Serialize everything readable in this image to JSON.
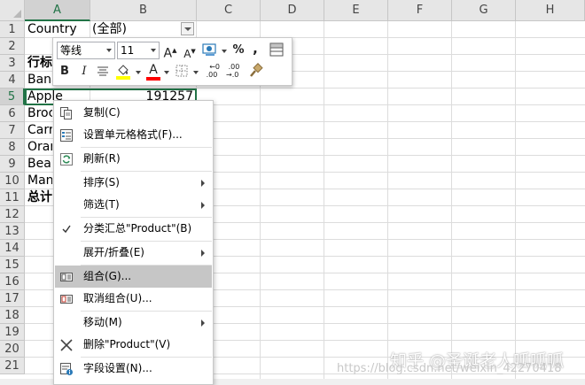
{
  "columns": [
    "A",
    "B",
    "C",
    "D",
    "E",
    "F",
    "G",
    "H"
  ],
  "selected_column": "A",
  "rows": [
    "1",
    "2",
    "3",
    "4",
    "5",
    "6",
    "7",
    "8",
    "9",
    "10",
    "11",
    "12",
    "13",
    "14",
    "15",
    "16",
    "17",
    "18",
    "19",
    "20",
    "21"
  ],
  "selected_row": "5",
  "cells": {
    "a1": "Country",
    "b1": "(全部)",
    "a3": "行标",
    "a4": "Bana",
    "a5": "Apple",
    "b5": "191257",
    "a6": "Broc",
    "a7": "Carr",
    "a8": "Orar",
    "a9": "Bear",
    "a10": "Man",
    "a11": "总计"
  },
  "mini_toolbar": {
    "font_name": "等线",
    "font_size": "11",
    "bold_label": "B",
    "italic_label": "I",
    "percent_label": "%",
    "comma_label": ",",
    "increase_font_label": "A",
    "decrease_font_label": "A",
    "font_color_label": "A",
    "increase_decimal_label": ".00",
    "decrease_decimal_label": ".00",
    "fill_color": "#ffff00",
    "font_color": "#ff0000"
  },
  "context_menu": {
    "items": [
      {
        "label": "复制(C)",
        "icon": "copy-icon"
      },
      {
        "label": "设置单元格格式(F)...",
        "icon": "format-cells-icon"
      },
      {
        "label": "刷新(R)",
        "icon": "refresh-icon"
      },
      {
        "label": "排序(S)",
        "submenu": true
      },
      {
        "label": "筛选(T)",
        "submenu": true
      },
      {
        "label": "分类汇总\"Product\"(B)",
        "checked": true
      },
      {
        "label": "展开/折叠(E)",
        "submenu": true
      },
      {
        "label": "组合(G)...",
        "icon": "group-icon",
        "highlighted": true
      },
      {
        "label": "取消组合(U)...",
        "icon": "ungroup-icon"
      },
      {
        "label": "移动(M)",
        "submenu": true
      },
      {
        "label": "删除\"Product\"(V)",
        "icon": "delete-x-icon"
      },
      {
        "label": "字段设置(N)...",
        "icon": "field-settings-icon"
      }
    ]
  },
  "watermark": {
    "line1": "知乎 @圣诞老人呱呱呱",
    "line2": "https://blog.csdn.net/weixin_42270418"
  },
  "colors": {
    "accent": "#217346",
    "header_bg": "#e6e6e6",
    "menu_highlight": "#c6c6c6"
  }
}
